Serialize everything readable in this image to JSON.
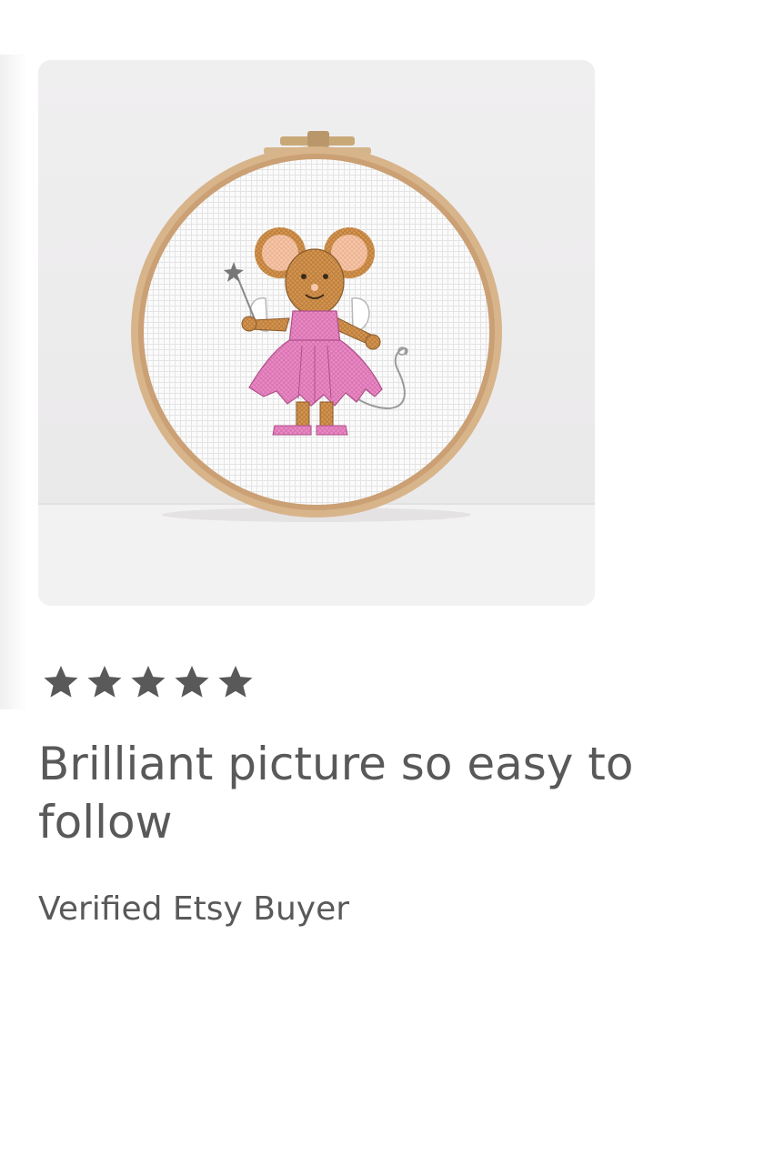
{
  "review": {
    "rating": 5,
    "rating_max": 5,
    "text": "Brilliant picture so easy to follow",
    "reviewer": "Verified Etsy Buyer"
  },
  "colors": {
    "text": "#595959",
    "star": "#595959",
    "dress_pink": "#e98ac4",
    "hoop_wood": "#d8b48a"
  },
  "icons": {
    "star": "star-icon"
  }
}
